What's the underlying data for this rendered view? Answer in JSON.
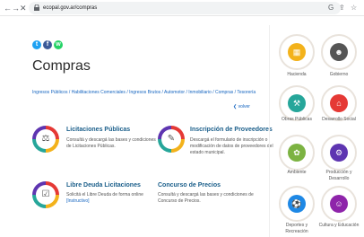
{
  "browser": {
    "back": "←",
    "forward": "→",
    "close": "✕",
    "url": "ecopal.gov.ar/compras"
  },
  "page": {
    "title": "Compras",
    "breadcrumb": "Ingresos Públicos / Habilitaciones Comerciales / Ingresos Brutos / Automotor / Inmobiliario / Compras / Tesorería",
    "volver": "❮ volver"
  },
  "cards": [
    {
      "title": "Licitaciones Públicas",
      "desc": "Consultá y descargá las bases y condiciones de Licitaciones Públicas."
    },
    {
      "title": "Inscripción de Proveedores",
      "desc": "Descargá el formulario de inscripción o modificación de datos de proveedores del estado municipal."
    },
    {
      "title": "Libre Deuda Licitaciones",
      "desc": "Solicitá el Libre Deuda de forma online",
      "link": "[Instructivo]"
    },
    {
      "title": "Concurso de Precios",
      "desc": "Consultá y descargá las bases y condiciones de Concurso de Precios."
    }
  ],
  "sidebar": [
    {
      "label": "Hacienda"
    },
    {
      "label": "Gobierno"
    },
    {
      "label": "Obras Públicas"
    },
    {
      "label": "Desarrollo Social"
    },
    {
      "label": "Ambiente"
    },
    {
      "label": "Producción y Desarrollo"
    },
    {
      "label": "Deportes y Recreación"
    },
    {
      "label": "Cultura y Educación"
    }
  ],
  "colors": {
    "accent_blue": "#1565c0",
    "title_blue": "#1a5e8a",
    "ring_gold": "#f3b21b",
    "ring_red": "#e53935",
    "ring_teal": "#26a69a"
  }
}
